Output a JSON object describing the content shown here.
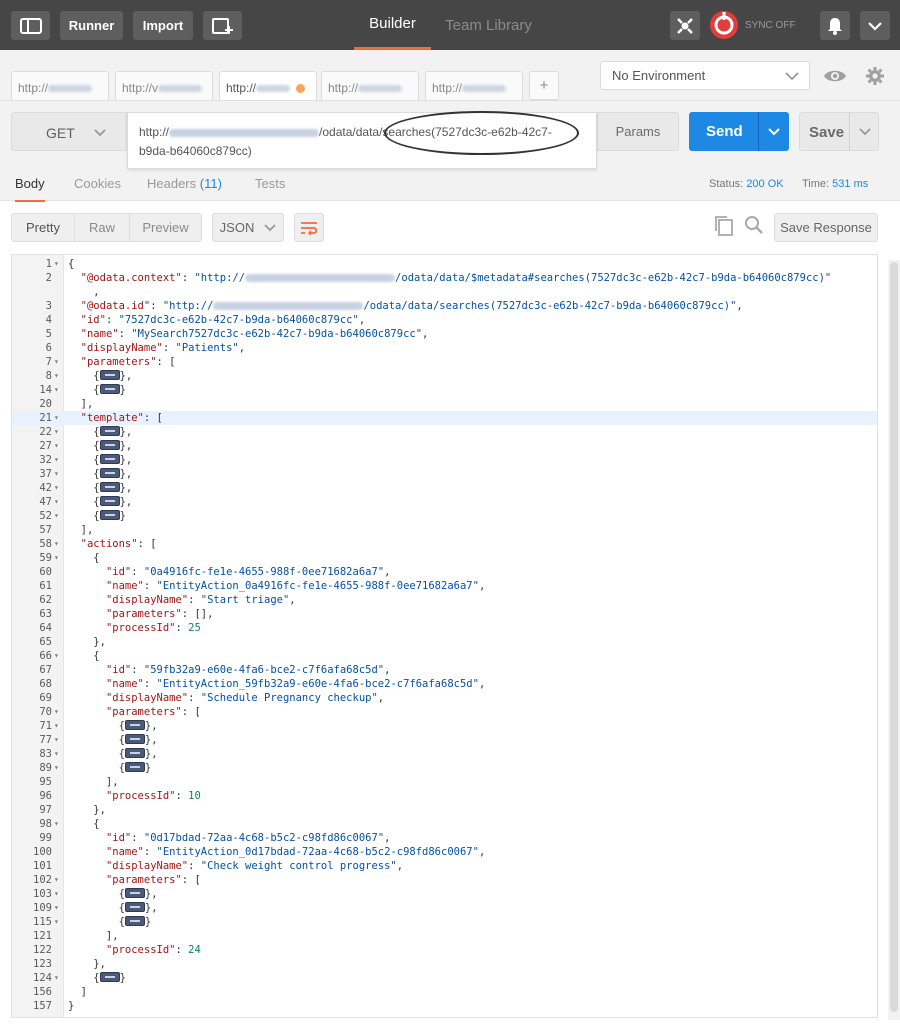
{
  "topbar": {
    "runner_label": "Runner",
    "import_label": "Import",
    "builder_label": "Builder",
    "team_library_label": "Team Library",
    "sync_label": "SYNC OFF"
  },
  "tabs": [
    {
      "label": "http://"
    },
    {
      "label": "http://v"
    },
    {
      "label": "http://"
    },
    {
      "label": "http://"
    },
    {
      "label": "http://"
    }
  ],
  "new_tab_label": "+",
  "environment": {
    "selected": "No Environment"
  },
  "request": {
    "method": "GET",
    "url_prefix": "http://",
    "url_suffix": "/odata/data/searches(7527dc3c-e62b-42c7-",
    "url_line2": "b9da-b64060c879cc)",
    "params_label": "Params",
    "send_label": "Send",
    "save_label": "Save"
  },
  "response": {
    "tabs": [
      "Body",
      "Cookies",
      "Headers",
      "Tests"
    ],
    "headers_count": "(11)",
    "status_label": "Status:",
    "status_value": "200 OK",
    "time_label": "Time:",
    "time_value": "531 ms",
    "views": [
      "Pretty",
      "Raw",
      "Preview"
    ],
    "format": "JSON",
    "save_response_label": "Save Response"
  },
  "code_lines": [
    {
      "n": "1",
      "f": true,
      "t": "{"
    },
    {
      "n": "2",
      "f": false,
      "t": "  \"@odata.context\": \"http://[URL]/odata/data/$metadata#searches(7527dc3c-e62b-42c7-b9da-b64060c879cc)\""
    },
    {
      "n": "",
      "f": false,
      "t": "    ,"
    },
    {
      "n": "3",
      "f": false,
      "t": "  \"@odata.id\": \"http://[URL]/odata/data/searches(7527dc3c-e62b-42c7-b9da-b64060c879cc)\","
    },
    {
      "n": "4",
      "f": false,
      "t": "  \"id\": \"7527dc3c-e62b-42c7-b9da-b64060c879cc\","
    },
    {
      "n": "5",
      "f": false,
      "t": "  \"name\": \"MySearch7527dc3c-e62b-42c7-b9da-b64060c879cc\","
    },
    {
      "n": "6",
      "f": false,
      "t": "  \"displayName\": \"Patients\","
    },
    {
      "n": "7",
      "f": true,
      "t": "  \"parameters\": ["
    },
    {
      "n": "8",
      "f": true,
      "t": "    {[PILL]},"
    },
    {
      "n": "14",
      "f": true,
      "t": "    {[PILL]}"
    },
    {
      "n": "20",
      "f": false,
      "t": "  ],"
    },
    {
      "n": "21",
      "f": true,
      "t": "  \"template\": [",
      "hl": true
    },
    {
      "n": "22",
      "f": true,
      "t": "    {[PILL]},"
    },
    {
      "n": "27",
      "f": true,
      "t": "    {[PILL]},"
    },
    {
      "n": "32",
      "f": true,
      "t": "    {[PILL]},"
    },
    {
      "n": "37",
      "f": true,
      "t": "    {[PILL]},"
    },
    {
      "n": "42",
      "f": true,
      "t": "    {[PILL]},"
    },
    {
      "n": "47",
      "f": true,
      "t": "    {[PILL]},"
    },
    {
      "n": "52",
      "f": true,
      "t": "    {[PILL]}"
    },
    {
      "n": "57",
      "f": false,
      "t": "  ],"
    },
    {
      "n": "58",
      "f": true,
      "t": "  \"actions\": ["
    },
    {
      "n": "59",
      "f": true,
      "t": "    {"
    },
    {
      "n": "60",
      "f": false,
      "t": "      \"id\": \"0a4916fc-fe1e-4655-988f-0ee71682a6a7\","
    },
    {
      "n": "61",
      "f": false,
      "t": "      \"name\": \"EntityAction_0a4916fc-fe1e-4655-988f-0ee71682a6a7\","
    },
    {
      "n": "62",
      "f": false,
      "t": "      \"displayName\": \"Start triage\","
    },
    {
      "n": "63",
      "f": false,
      "t": "      \"parameters\": [],"
    },
    {
      "n": "64",
      "f": false,
      "t": "      \"processId\": 25"
    },
    {
      "n": "65",
      "f": false,
      "t": "    },"
    },
    {
      "n": "66",
      "f": true,
      "t": "    {"
    },
    {
      "n": "67",
      "f": false,
      "t": "      \"id\": \"59fb32a9-e60e-4fa6-bce2-c7f6afa68c5d\","
    },
    {
      "n": "68",
      "f": false,
      "t": "      \"name\": \"EntityAction_59fb32a9-e60e-4fa6-bce2-c7f6afa68c5d\","
    },
    {
      "n": "69",
      "f": false,
      "t": "      \"displayName\": \"Schedule Pregnancy checkup\","
    },
    {
      "n": "70",
      "f": true,
      "t": "      \"parameters\": ["
    },
    {
      "n": "71",
      "f": true,
      "t": "        {[PILL]},"
    },
    {
      "n": "77",
      "f": true,
      "t": "        {[PILL]},"
    },
    {
      "n": "83",
      "f": true,
      "t": "        {[PILL]},"
    },
    {
      "n": "89",
      "f": true,
      "t": "        {[PILL]}"
    },
    {
      "n": "95",
      "f": false,
      "t": "      ],"
    },
    {
      "n": "96",
      "f": false,
      "t": "      \"processId\": 10"
    },
    {
      "n": "97",
      "f": false,
      "t": "    },"
    },
    {
      "n": "98",
      "f": true,
      "t": "    {"
    },
    {
      "n": "99",
      "f": false,
      "t": "      \"id\": \"0d17bdad-72aa-4c68-b5c2-c98fd86c0067\","
    },
    {
      "n": "100",
      "f": false,
      "t": "      \"name\": \"EntityAction_0d17bdad-72aa-4c68-b5c2-c98fd86c0067\","
    },
    {
      "n": "101",
      "f": false,
      "t": "      \"displayName\": \"Check weight control progress\","
    },
    {
      "n": "102",
      "f": true,
      "t": "      \"parameters\": ["
    },
    {
      "n": "103",
      "f": true,
      "t": "        {[PILL]},"
    },
    {
      "n": "109",
      "f": true,
      "t": "        {[PILL]},"
    },
    {
      "n": "115",
      "f": true,
      "t": "        {[PILL]}"
    },
    {
      "n": "121",
      "f": false,
      "t": "      ],"
    },
    {
      "n": "122",
      "f": false,
      "t": "      \"processId\": 24"
    },
    {
      "n": "123",
      "f": false,
      "t": "    },"
    },
    {
      "n": "124",
      "f": true,
      "t": "    {[PILL]}"
    },
    {
      "n": "156",
      "f": false,
      "t": "  ]"
    },
    {
      "n": "157",
      "f": false,
      "t": "}"
    }
  ],
  "colors": {
    "topbar": "#464646",
    "accent": "#f26b3a",
    "send": "#1e88e5",
    "sync_icon": "#e23d3d"
  }
}
